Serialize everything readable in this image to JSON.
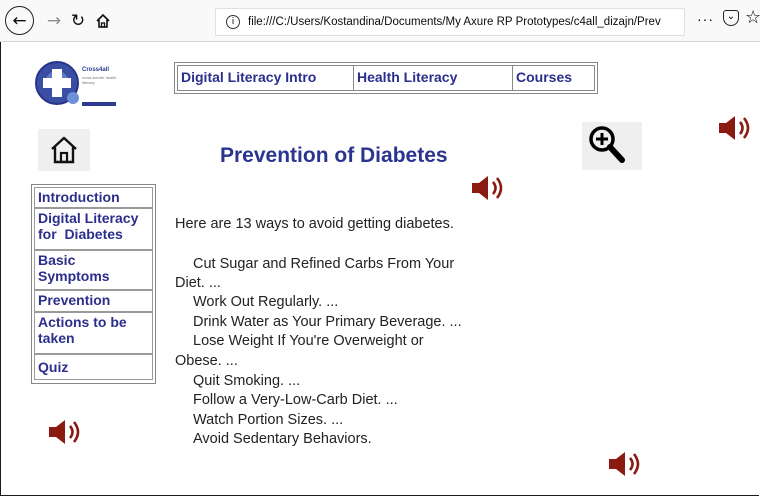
{
  "browser": {
    "url": "file:///C:/Users/Kostandina/Documents/My Axure RP Prototypes/c4all_dizajn/Prev",
    "menu_dots": "···"
  },
  "logo": {
    "name": "Cross4all",
    "tagline": "cross-border health literacy",
    "footer": "Interreg IPA CBC"
  },
  "topnav": {
    "items": [
      "Digital Literacy Intro",
      "Health Literacy",
      "Courses"
    ]
  },
  "page": {
    "title": "Prevention of Diabetes",
    "intro": "Here are 13 ways to avoid getting diabetes.",
    "lines": [
      "Cut Sugar and Refined Carbs From Your",
      "Diet. ...",
      "Work Out Regularly. ...",
      "Drink Water as Your Primary Beverage. ...",
      "Lose Weight If You're Overweight or",
      "Obese. ...",
      "Quit Smoking. ...",
      "Follow a Very-Low-Carb Diet. ...",
      "Watch Portion Sizes. ...",
      "Avoid Sedentary Behaviors."
    ]
  },
  "sidebar": {
    "items": [
      {
        "line1": "Introduction",
        "line2": ""
      },
      {
        "line1": "Digital Literacy",
        "line2": "for  Diabetes"
      },
      {
        "line1": "Basic",
        "line2": "Symptoms"
      },
      {
        "line1": "Prevention",
        "line2": ""
      },
      {
        "line1": "Actions to be",
        "line2": "taken"
      },
      {
        "line1": "Quiz",
        "line2": ""
      }
    ]
  },
  "colors": {
    "nav_text": "#2b2f8c",
    "title": "#2b3590",
    "speaker": "#8b1a12"
  },
  "icons": {
    "home": "home-icon",
    "zoom": "zoom-in-icon",
    "speaker": "speaker-icon"
  }
}
